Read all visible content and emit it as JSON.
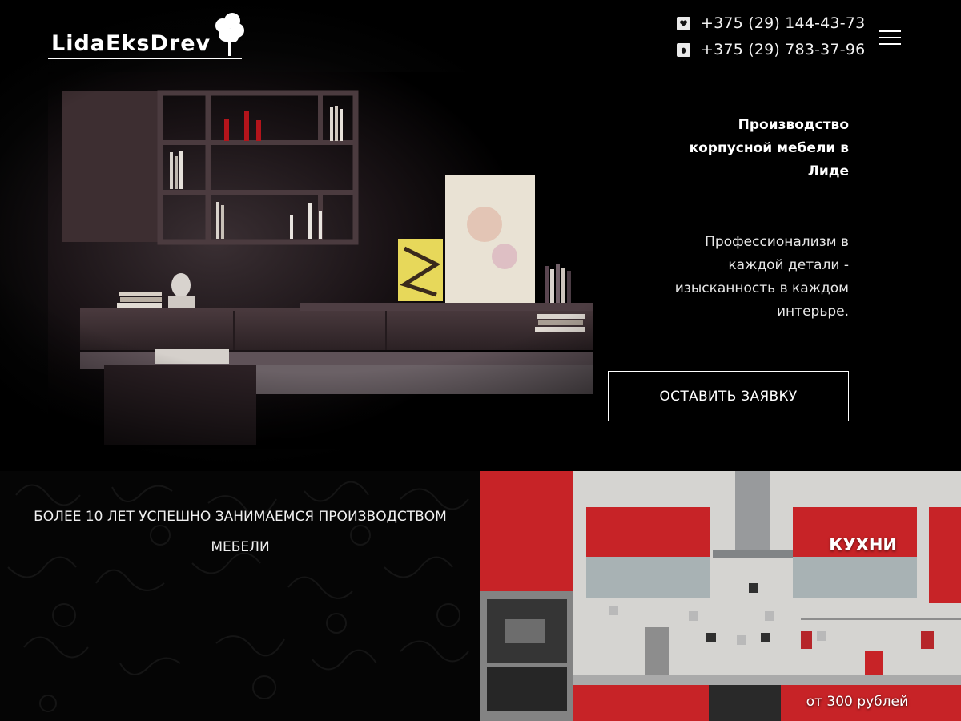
{
  "header": {
    "logo_text": "LidaEksDrev",
    "phones": [
      {
        "icon": "viber-icon",
        "number": "+375 (29) 144-43-73"
      },
      {
        "icon": "mts-icon",
        "number": "+375 (29) 783-37-96"
      }
    ],
    "menu_icon": "hamburger-menu-icon"
  },
  "hero": {
    "title": "Производство корпусной мебели в Лиде",
    "subtitle": "Профессионализм в каждой детали - изысканность в каждом интерьре.",
    "cta_label": "ОСТАВИТЬ ЗАЯВКУ"
  },
  "about": {
    "text": "БОЛЕЕ 10 ЛЕТ УСПЕШНО ЗАНИМАЕМСЯ ПРОИЗВОДСТВОМ МЕБЕЛИ"
  },
  "catalog": {
    "items": [
      {
        "title": "КУХНИ",
        "price": "от 300 рублей"
      }
    ]
  },
  "colors": {
    "background": "#000000",
    "text": "#ffffff",
    "kitchen_red": "#d8262b"
  }
}
